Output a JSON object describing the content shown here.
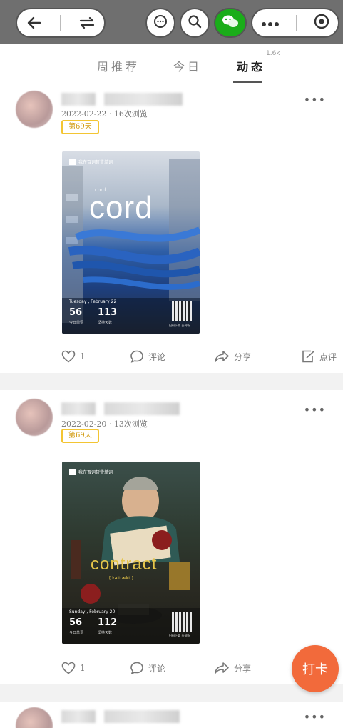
{
  "tabs": {
    "items": [
      {
        "label": "周推荐"
      },
      {
        "label": "今日"
      },
      {
        "label": "动态"
      }
    ],
    "active_index": 2,
    "count_badge": "1.6k"
  },
  "side_more": {
    "label": "更多"
  },
  "posts": [
    {
      "meta": "2022-02-22 · 16次浏览",
      "day_tag": "第69天",
      "card": {
        "brand": "我在百词斩背单词",
        "word": "cord",
        "word_tag": "cord",
        "date": "Tuesday , February 22",
        "stat_left": "56",
        "stat_left_label": "今日单词",
        "stat_right": "113",
        "stat_right_label": "坚持天数",
        "qr_caption": "扫码下载 百词斩"
      },
      "actions": {
        "like": "1",
        "comment": "评论",
        "share": "分享",
        "note": "点评"
      }
    },
    {
      "meta": "2022-02-20 · 13次浏览",
      "day_tag": "第69天",
      "card": {
        "brand": "我在百词斩背单词",
        "word": "contract",
        "phonetic": "[ kə'trækt ]",
        "date": "Sunday , February 20",
        "stat_left": "56",
        "stat_left_label": "今日单词",
        "stat_right": "112",
        "stat_right_label": "坚持天数",
        "qr_caption": "扫码下载 百词斩"
      },
      "actions": {
        "like": "1",
        "comment": "评论",
        "share": "分享"
      }
    }
  ],
  "fab": {
    "label": "打卡"
  },
  "colors": {
    "accent": "#f26a3b",
    "tag_border": "#f3c533",
    "wechat_green": "#1aad19"
  }
}
